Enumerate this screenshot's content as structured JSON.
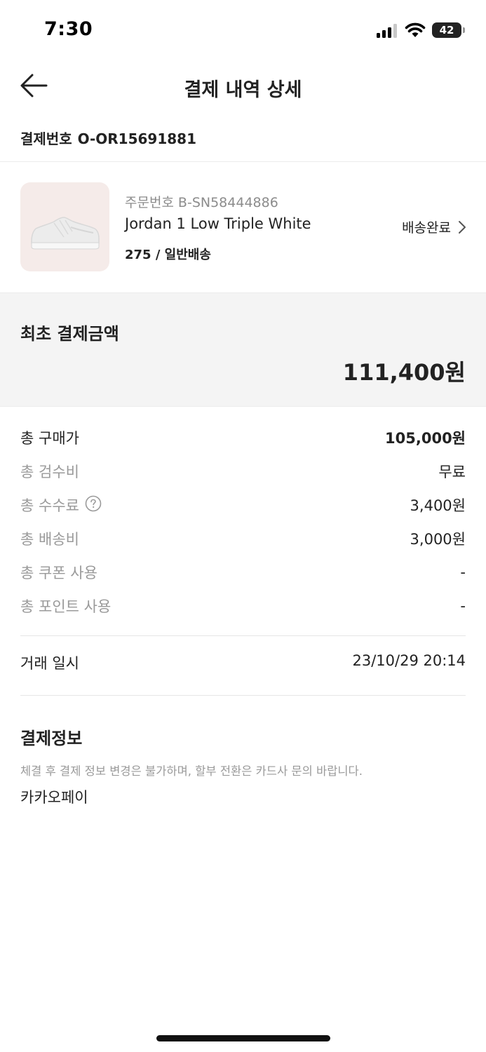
{
  "status_bar": {
    "time": "7:30",
    "battery": "42"
  },
  "header": {
    "title": "결제 내역 상세"
  },
  "payment_number": {
    "label": "결제번호",
    "value": "O-OR15691881"
  },
  "product": {
    "order_label": "주문번호",
    "order_number": "B-SN58444886",
    "name": "Jordan 1 Low Triple White",
    "option": "275 / 일반배송",
    "status": "배송완료",
    "thumb_bg": "#f5ebe9"
  },
  "summary": {
    "label": "최초 결제금액",
    "amount": "111,400원"
  },
  "breakdown": [
    {
      "label": "총 구매가",
      "value": "105,000원"
    },
    {
      "label": "총 검수비",
      "value": "무료"
    },
    {
      "label": "총 수수료",
      "value": "3,400원"
    },
    {
      "label": "총 배송비",
      "value": "3,000원"
    },
    {
      "label": "총 쿠폰 사용",
      "value": "-"
    },
    {
      "label": "총 포인트 사용",
      "value": "-"
    }
  ],
  "trade": {
    "label": "거래 일시",
    "value": "23/10/29 20:14"
  },
  "payment_info": {
    "title": "결제정보",
    "note": "체결 후 결제 정보 변경은 불가하며, 할부 전환은 카드사 문의 바랍니다.",
    "method": "카카오페이"
  }
}
